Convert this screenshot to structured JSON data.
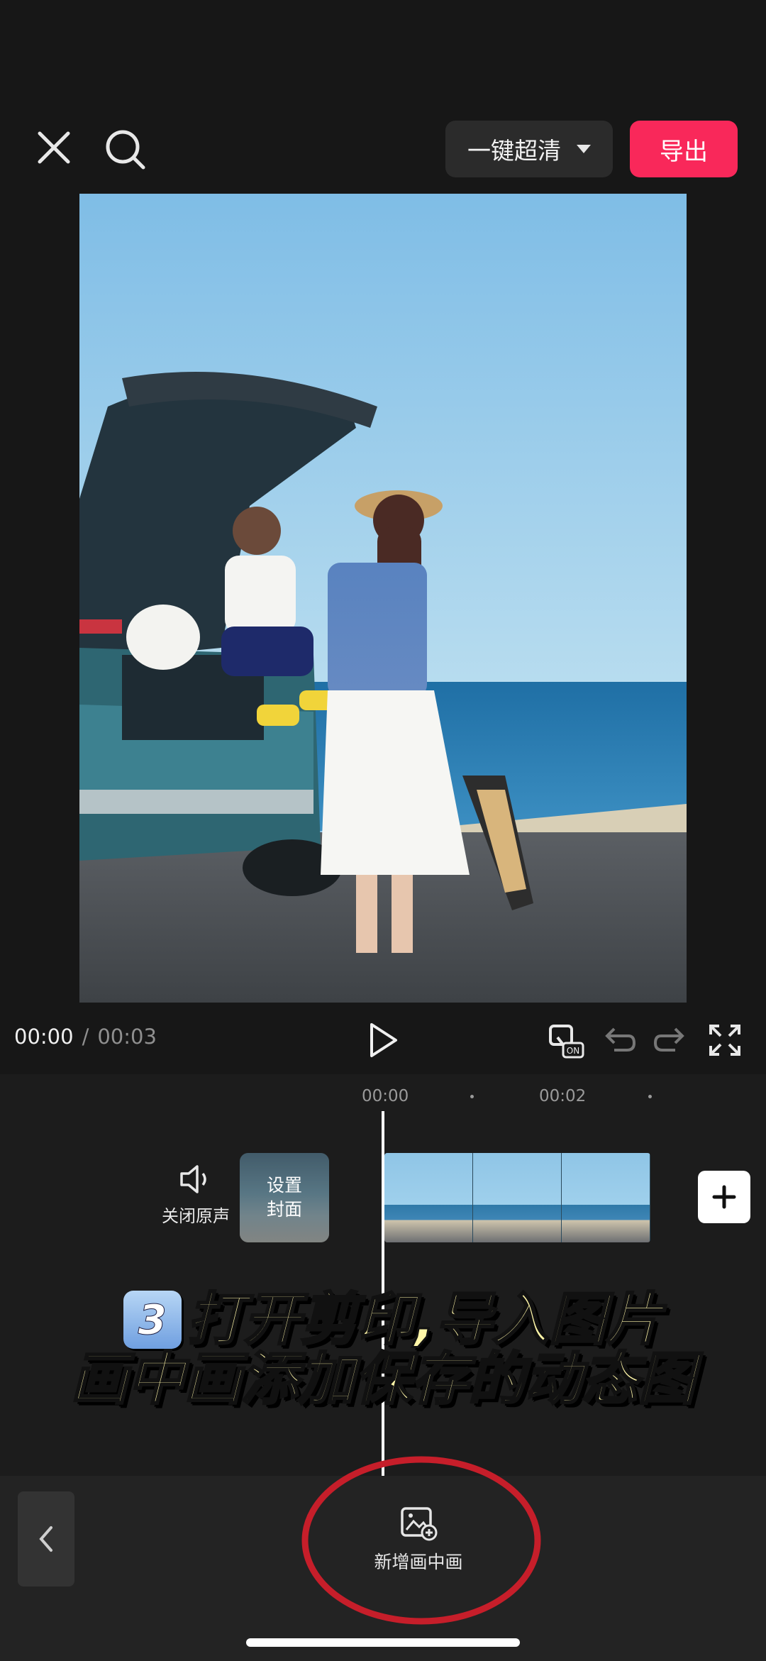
{
  "top_bar": {
    "quality_label": "一键超清",
    "export_label": "导出"
  },
  "player": {
    "time_current": "00:00",
    "time_separator": "/",
    "time_total": "00:03"
  },
  "timeline": {
    "ticks": [
      "00:00",
      "00:02"
    ],
    "mute_label": "关闭原声",
    "cover_label": "设置\n封面"
  },
  "caption": {
    "step_badge": "3",
    "line1": "打开剪印,导入图片",
    "line2": "画中画添加保存的动态图"
  },
  "toolbar": {
    "pip_label": "新增画中画"
  },
  "colors": {
    "export_button": "#f9285a",
    "caption_text": "#fff6a8",
    "annotation_ellipse": "#c61e2a"
  }
}
